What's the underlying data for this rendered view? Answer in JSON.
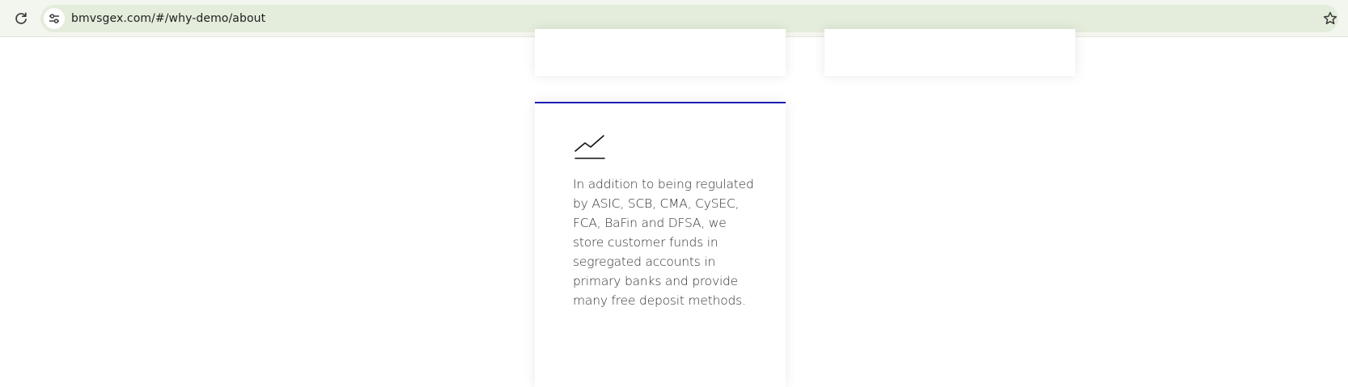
{
  "browser": {
    "url": "bmvsgex.com/#/why-demo/about",
    "icons": {
      "reload": "reload-icon",
      "site_info": "tune-icon",
      "bookmark": "star-icon"
    }
  },
  "page": {
    "feature_card": {
      "accent_color": "#1b1fb3",
      "icon": "line-chart-icon",
      "text": "In addition to being regulated by ASIC, SCB, CMA, CySEC, FCA, BaFin and DFSA, we store customer funds in segregated accounts in primary banks and provide many free deposit methods."
    }
  }
}
